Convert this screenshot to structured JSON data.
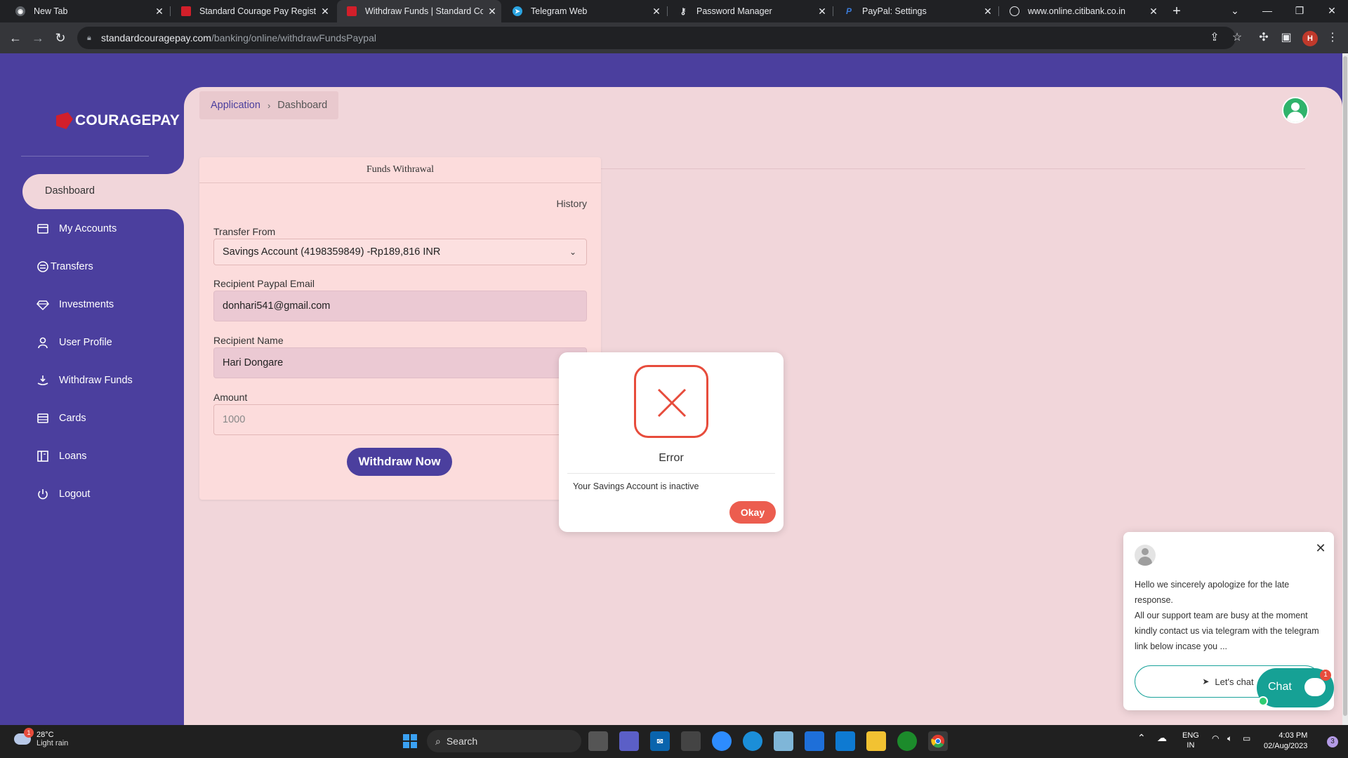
{
  "browser": {
    "tabs": [
      {
        "title": "New Tab",
        "favicon": "chrome-icon",
        "active": false
      },
      {
        "title": "Standard Courage Pay Register f",
        "favicon": "couragepay-icon",
        "active": false
      },
      {
        "title": "Withdraw Funds | Standard Cour",
        "favicon": "couragepay-icon",
        "active": true
      },
      {
        "title": "Telegram Web",
        "favicon": "telegram-icon",
        "active": false
      },
      {
        "title": "Password Manager",
        "favicon": "key-icon",
        "active": false
      },
      {
        "title": "PayPal: Settings",
        "favicon": "paypal-icon",
        "active": false
      },
      {
        "title": "www.online.citibank.co.in",
        "favicon": "globe-icon",
        "active": false
      }
    ],
    "url_host": "standardcouragepay.com",
    "url_path": "/banking/online/withdrawFundsPaypal",
    "profile_initial": "H"
  },
  "sidebar": {
    "logo_text": "COURAGEPAY",
    "active_item": "Dashboard",
    "items": [
      {
        "label": "My Accounts",
        "icon": "accounts-icon"
      },
      {
        "label": "Transfers",
        "icon": "transfers-icon"
      },
      {
        "label": "Investments",
        "icon": "diamond-icon"
      },
      {
        "label": "User Profile",
        "icon": "user-icon"
      },
      {
        "label": "Withdraw Funds",
        "icon": "withdraw-icon"
      },
      {
        "label": "Cards",
        "icon": "card-icon"
      },
      {
        "label": "Loans",
        "icon": "loans-icon"
      },
      {
        "label": "Logout",
        "icon": "power-icon"
      }
    ]
  },
  "breadcrumb": {
    "parent": "Application",
    "current": "Dashboard"
  },
  "withdraw_form": {
    "title": "Funds Withrawal",
    "history_link": "History",
    "transfer_from_label": "Transfer From",
    "transfer_from_value": "Savings Account (4198359849) -Rp189,816 INR",
    "email_label": "Recipient Paypal Email",
    "email_value": "donhari541@gmail.com",
    "name_label": "Recipient Name",
    "name_value": "Hari Dongare",
    "amount_label": "Amount",
    "amount_placeholder": "1000",
    "submit_label": "Withdraw Now"
  },
  "error_modal": {
    "title": "Error",
    "message": "Your Savings Account is inactive",
    "ok_label": "Okay",
    "accent": "#e74c3c"
  },
  "chat_widget": {
    "message_line1": "Hello we sincerely apologize for the late response.",
    "message_line2": "All our support team are busy at the moment kindly contact us via telegram with the telegram link below incase you ...",
    "cta_label": "Let's chat",
    "launcher_label": "Chat",
    "badge_count": "1",
    "accent": "#16a195"
  },
  "taskbar": {
    "weather_temp": "28°C",
    "weather_desc": "Light rain",
    "weather_badge": "1",
    "search_label": "Search",
    "lang_line1": "ENG",
    "lang_line2": "IN",
    "time": "4:03 PM",
    "date": "02/Aug/2023",
    "notification_count": "3"
  },
  "colors": {
    "sidebar_bg": "#4b3f9e",
    "content_bg": "#f1d6da",
    "card_bg": "#fcdcdc",
    "primary": "#4b3f9e",
    "danger": "#ec5d4f"
  }
}
